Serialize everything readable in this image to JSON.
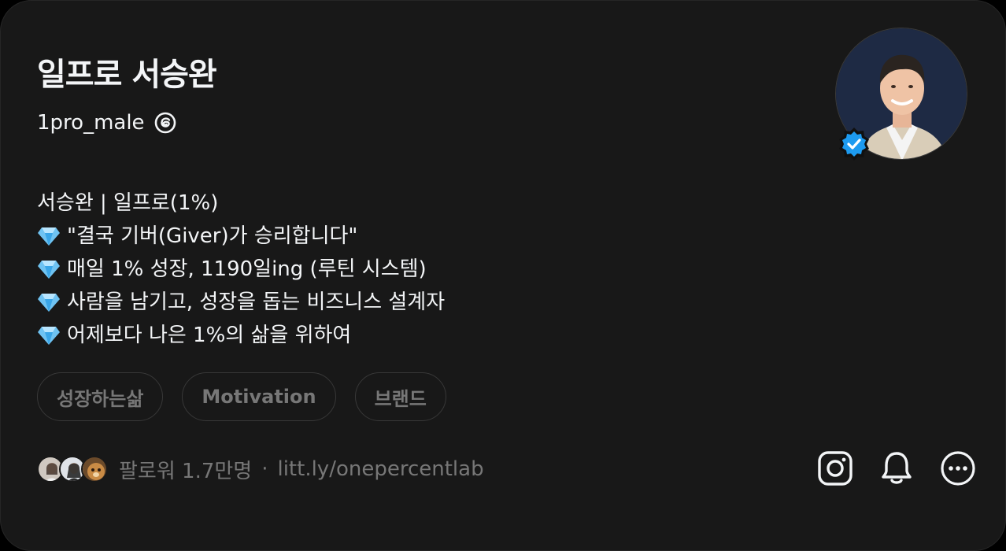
{
  "profile": {
    "name": "일프로 서승완",
    "handle": "1pro_male"
  },
  "bio": {
    "line1": "서승완 | 일프로(1%)",
    "line2": "\"결국 기버(Giver)가 승리합니다\"",
    "line3": "매일 1% 성장, 1190일ing (루틴 시스템)",
    "line4": "사람을 남기고, 성장을 돕는 비즈니스 설계자",
    "line5": "어제보다 나은 1%의 삶을 위하여",
    "bullet_icon": "gem-icon"
  },
  "tags": [
    "성장하는삶",
    "Motivation",
    "브랜드"
  ],
  "footer": {
    "followers": "팔로워 1.7만명",
    "separator": "·",
    "link": "litt.ly/onepercentlab"
  },
  "actions": [
    "instagram-icon",
    "bell-icon",
    "more-icon"
  ],
  "colors": {
    "background": "#181818",
    "text": "#f3f5f7",
    "muted": "#777777",
    "verified": "#1d9bf0"
  }
}
